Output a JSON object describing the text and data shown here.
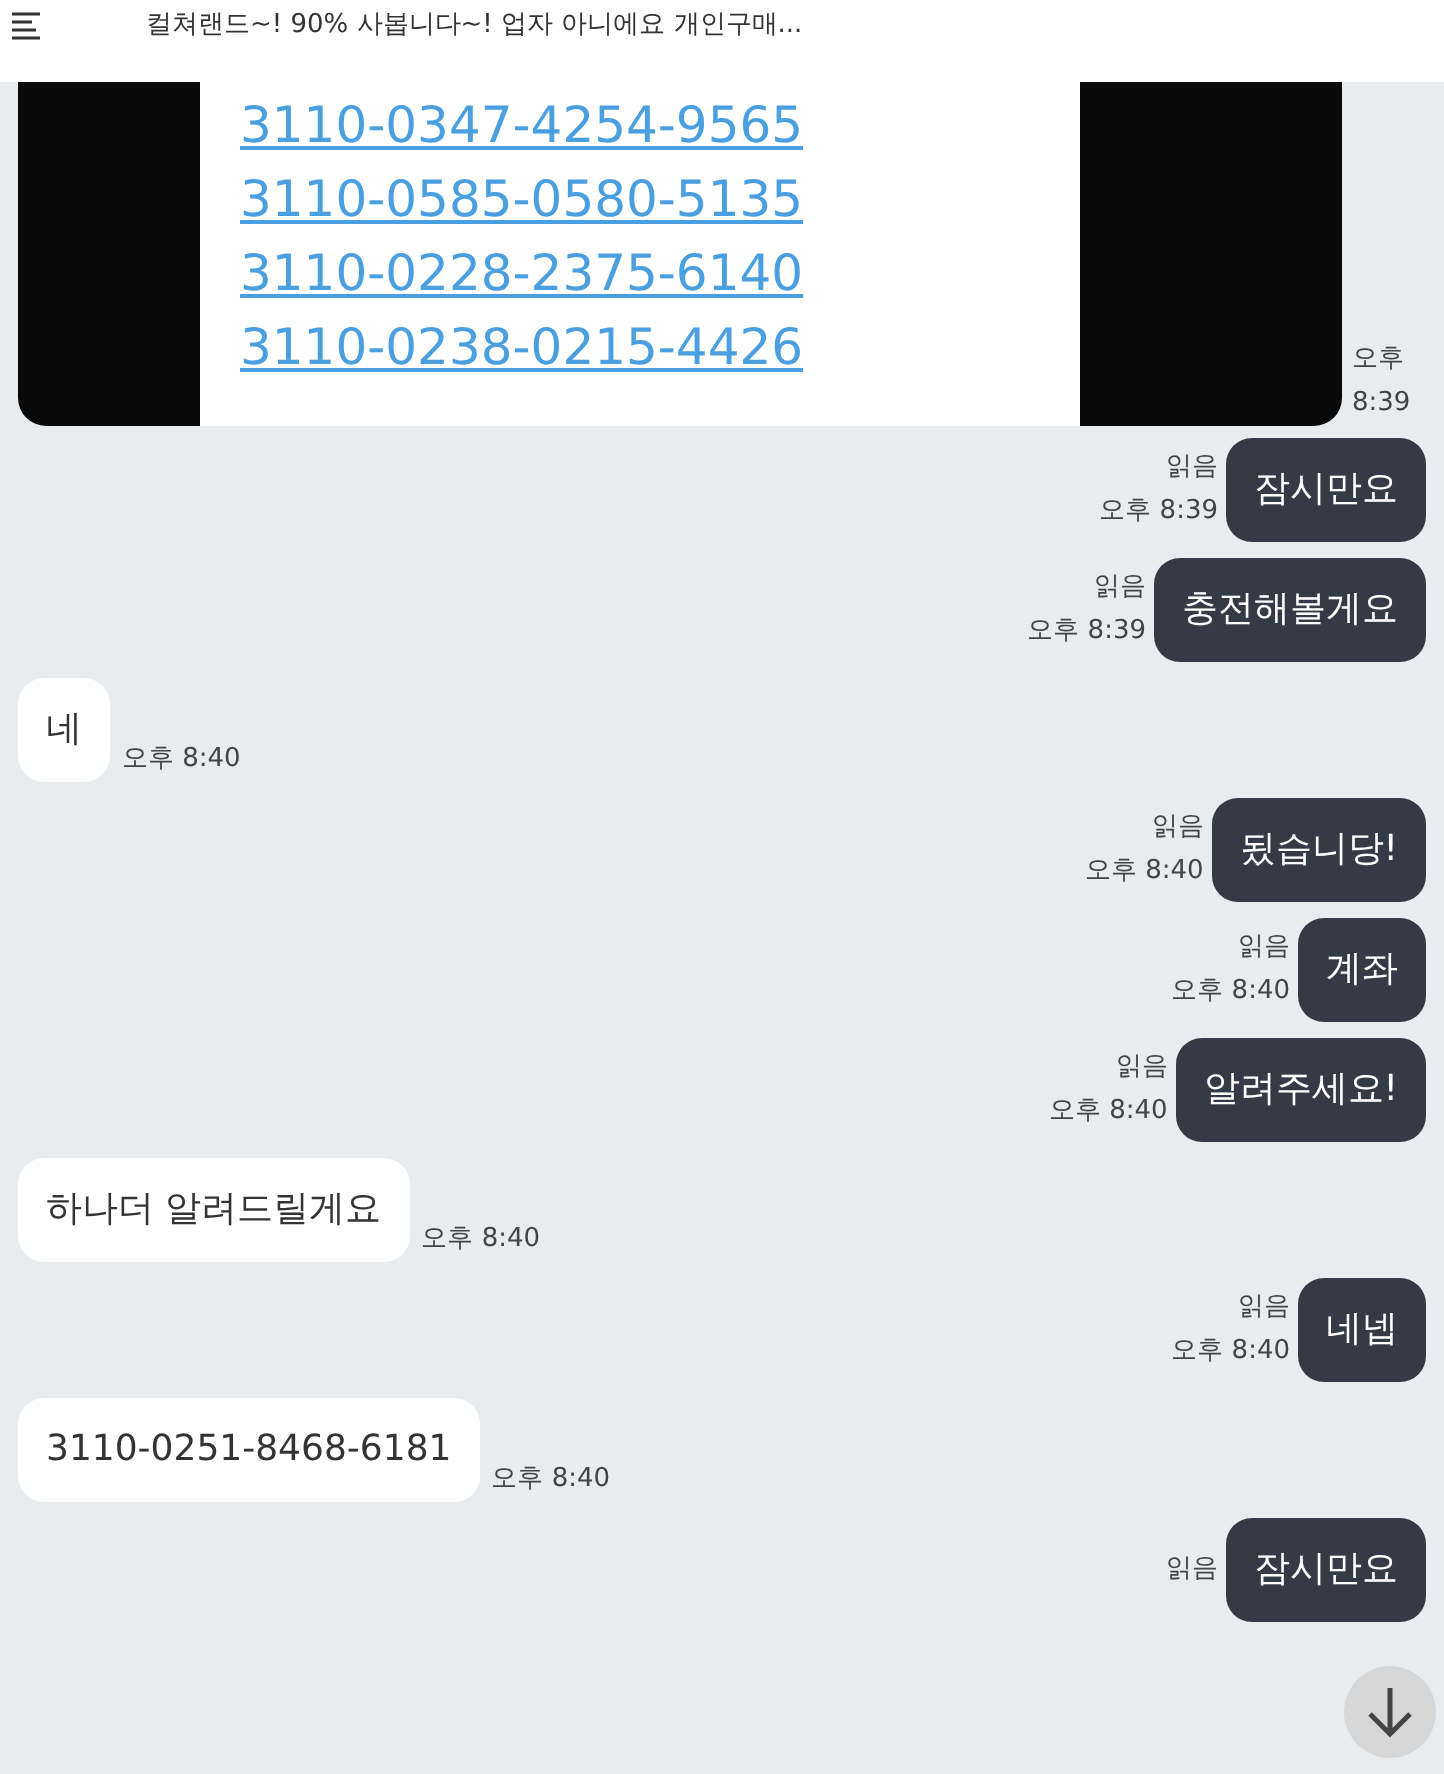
{
  "header": {
    "title": "컬쳐랜드~! 90% 사봅니다~! 업자 아니에요 개인구매..."
  },
  "messages": [
    {
      "kind": "image",
      "links": [
        "3110-0347-4254-9565",
        "3110-0585-0580-5135",
        "3110-0228-2375-6140",
        "3110-0238-0215-4426"
      ],
      "time_period": "오후",
      "time": "8:39"
    },
    {
      "kind": "sent",
      "text": "잠시만요",
      "read": "읽음",
      "time": "오후 8:39"
    },
    {
      "kind": "sent",
      "text": "충전해볼게요",
      "read": "읽음",
      "time": "오후 8:39"
    },
    {
      "kind": "received",
      "text": "네",
      "time": "오후 8:40"
    },
    {
      "kind": "sent",
      "text": "됬습니당!",
      "read": "읽음",
      "time": "오후 8:40"
    },
    {
      "kind": "sent",
      "text": "계좌",
      "read": "읽음",
      "time": "오후 8:40"
    },
    {
      "kind": "sent",
      "text": "알려주세요!",
      "read": "읽음",
      "time": "오후 8:40"
    },
    {
      "kind": "received",
      "text": "하나더 알려드릴게요",
      "time": "오후 8:40"
    },
    {
      "kind": "sent",
      "text": "네넵",
      "read": "읽음",
      "time": "오후 8:40"
    },
    {
      "kind": "received",
      "text": "3110-0251-8468-6181",
      "time": "오후 8:40"
    },
    {
      "kind": "sent",
      "text": "잠시만요",
      "read": "읽음"
    }
  ]
}
